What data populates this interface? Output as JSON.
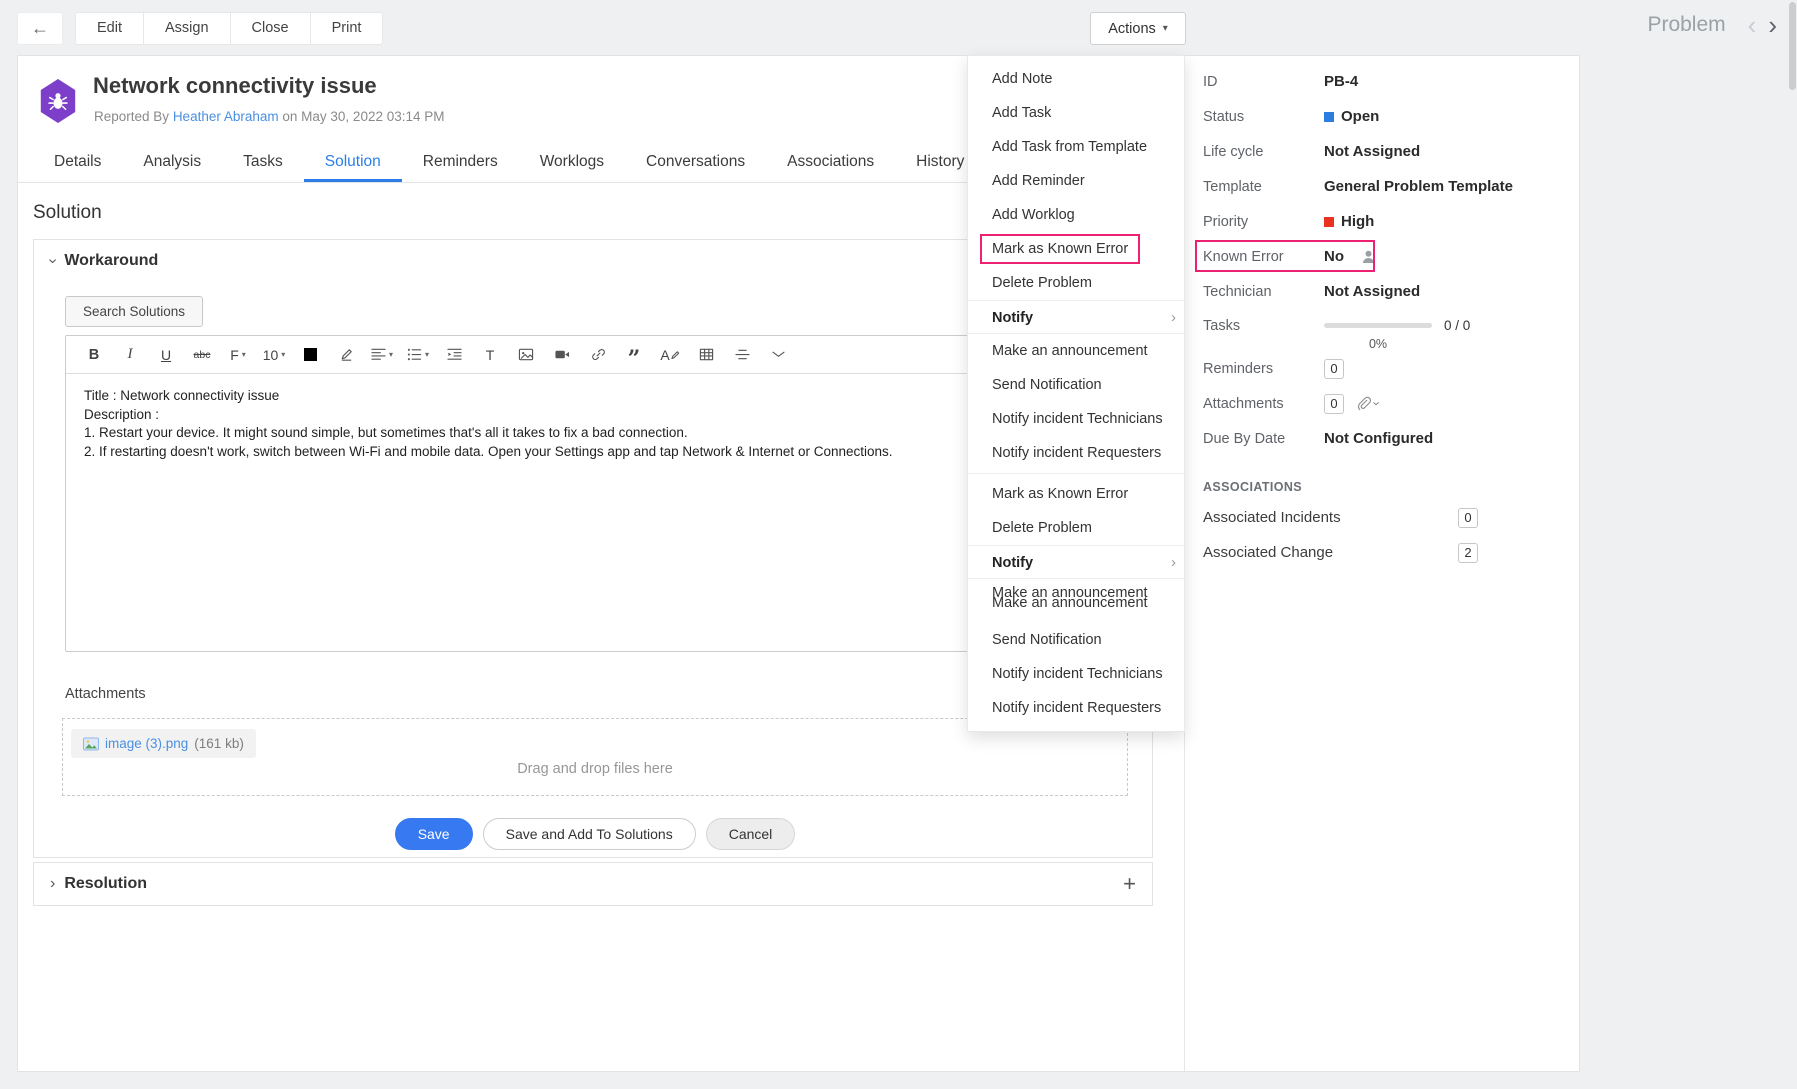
{
  "icons": {
    "back": "←",
    "caret_down": "▾",
    "prev": "‹",
    "next": "›",
    "chevron": "›",
    "plus": "+",
    "quote": "”"
  },
  "topbar": {
    "edit": "Edit",
    "assign": "Assign",
    "close": "Close",
    "print": "Print",
    "actions": "Actions",
    "module": "Problem"
  },
  "header": {
    "title": "Network connectivity issue",
    "reported_by": "Reported By",
    "reporter": "Heather Abraham",
    "reported_on": "on May 30, 2022 03:14 PM"
  },
  "tabs": [
    "Details",
    "Analysis",
    "Tasks",
    "Solution",
    "Reminders",
    "Worklogs",
    "Conversations",
    "Associations",
    "History"
  ],
  "active_tab": "Solution",
  "solution": {
    "section_title": "Solution",
    "workaround_title": "Workaround",
    "search_button": "Search Solutions",
    "editor": {
      "glyphs": {
        "bold": "B",
        "italic": "I",
        "underline": "U",
        "strike": "abc",
        "font": "F",
        "size": "10",
        "text_style": "T",
        "spell": "A"
      },
      "lines": [
        "Title : Network connectivity issue",
        "Description :",
        "1. Restart your device. It might sound simple, but sometimes that's all it takes to fix a bad connection.",
        "2. If restarting doesn't work, switch between Wi-Fi and mobile data. Open your Settings app and tap Network & Internet or Connections."
      ]
    },
    "attachments_label": "Attachments",
    "attachment": {
      "name": "image (3).png",
      "size": "(161 kb)"
    },
    "dropzone_text": "Drag and drop files here",
    "buttons": {
      "save": "Save",
      "save_add": "Save and Add To Solutions",
      "cancel": "Cancel"
    },
    "resolution_title": "Resolution"
  },
  "actions_menu": {
    "items": [
      {
        "label": "Add Note"
      },
      {
        "label": "Add Task"
      },
      {
        "label": "Add Task from Template"
      },
      {
        "label": "Add Reminder"
      },
      {
        "label": "Add Worklog"
      },
      {
        "label": "Mark as Known Error",
        "highlighted": true
      },
      {
        "label": "Delete Problem"
      },
      {
        "label": "Notify",
        "submenu": true
      },
      {
        "label": "Make an announcement"
      },
      {
        "label": "Send Notification"
      },
      {
        "label": "Notify incident Technicians"
      },
      {
        "label": "Notify incident Requesters"
      },
      {
        "label": "Mark as Known Error"
      },
      {
        "label": "Delete Problem"
      },
      {
        "label": "Notify",
        "submenu": true
      },
      {
        "label": "Make an announcement",
        "ghost": true
      },
      {
        "label": "Send Notification"
      },
      {
        "label": "Notify incident Technicians"
      },
      {
        "label": "Notify incident Requesters"
      }
    ]
  },
  "panel": {
    "id": {
      "label": "ID",
      "value": "PB-4"
    },
    "status": {
      "label": "Status",
      "value": "Open",
      "color": "#2e7de1"
    },
    "life_cycle": {
      "label": "Life cycle",
      "value": "Not Assigned"
    },
    "template": {
      "label": "Template",
      "value": "General Problem Template"
    },
    "priority": {
      "label": "Priority",
      "value": "High",
      "color": "#ea3223"
    },
    "known_error": {
      "label": "Known Error",
      "value": "No"
    },
    "technician": {
      "label": "Technician",
      "value": "Not Assigned"
    },
    "tasks": {
      "label": "Tasks",
      "count": "0 / 0",
      "percent": "0%"
    },
    "reminders": {
      "label": "Reminders",
      "count": "0"
    },
    "attachments": {
      "label": "Attachments",
      "count": "0"
    },
    "due_by": {
      "label": "Due By Date",
      "value": "Not Configured"
    },
    "associations_title": "ASSOCIATIONS",
    "associated_incidents": {
      "label": "Associated Incidents",
      "count": "0"
    },
    "associated_change": {
      "label": "Associated Change",
      "count": "2"
    }
  },
  "colors": {
    "highlight_pink": "#ec2172",
    "tab_active_blue": "#2b7de9",
    "save_blue": "#3779f0",
    "status_open_blue": "#2e7de1",
    "priority_high_red": "#ea3223",
    "bug_purple": "#7d3fc9",
    "link_blue": "#4a8fe2"
  }
}
